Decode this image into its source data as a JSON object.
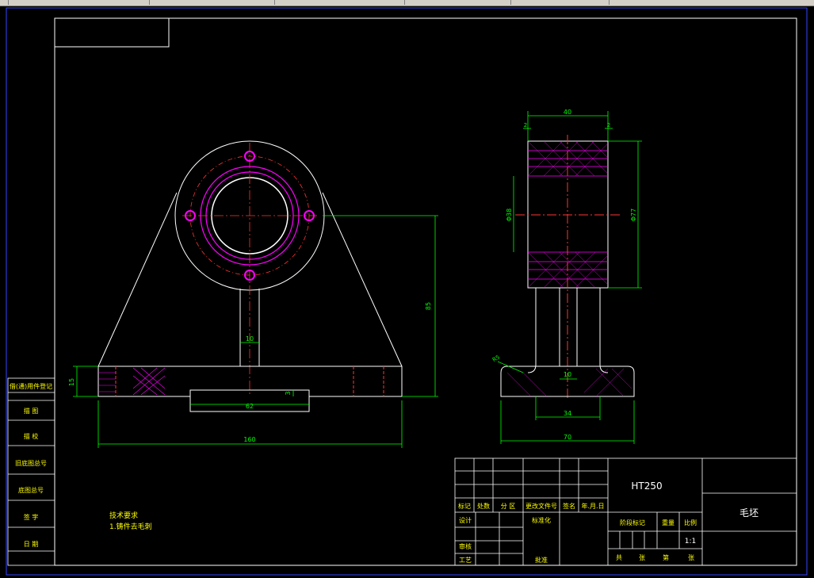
{
  "colors": {
    "background": "#000000",
    "outline": "#ffffff",
    "dimension": "#00ff00",
    "centerline": "#ff0000",
    "hidden": "#ff00ff",
    "border": "#0000ff",
    "title_text": "#ffff00"
  },
  "dims_front": {
    "web_width": "10",
    "height_85": "85",
    "base_15": "15",
    "slot_3": "3",
    "slot_62": "62",
    "overall_160": "160"
  },
  "dims_side": {
    "top_40": "40",
    "left_2": "2",
    "right_2": "2",
    "bore_d38": "Φ38",
    "outer_d77": "Φ77",
    "r5": "R5",
    "web_10": "10",
    "base_34": "34",
    "base_70": "70"
  },
  "left_table": [
    "借(通)用件登记",
    "描 图",
    "描 校",
    "旧底图总号",
    "底图总号",
    "签 字",
    "日 期"
  ],
  "notes": {
    "title": "技术要求",
    "line1": "1.铸件去毛刺"
  },
  "title_block": {
    "material": "HT250",
    "part_name": "毛坯",
    "scale": "1:1",
    "rev_headers": [
      "标记",
      "处数",
      "分 区",
      "更改文件号",
      "签名",
      "年.月.日"
    ],
    "design": "设计",
    "standardization": "标准化",
    "review": "审核",
    "process": "工艺",
    "approve": "批准",
    "stage_mark": "阶段标记",
    "weight": "重量",
    "ratio": "比例",
    "total": "共",
    "sheet": "张",
    "page": "第",
    "sheet2": "张"
  }
}
